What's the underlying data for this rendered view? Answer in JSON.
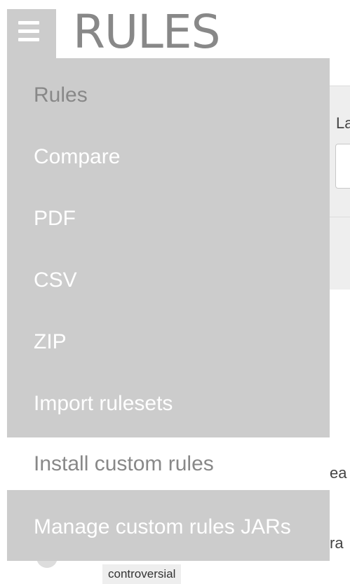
{
  "header": {
    "title": "RULES",
    "menu_icon": "hamburger-menu-icon"
  },
  "menu": {
    "items": [
      {
        "label": "Rules",
        "state": "current"
      },
      {
        "label": "Compare",
        "state": "normal"
      },
      {
        "label": "PDF",
        "state": "normal"
      },
      {
        "label": "CSV",
        "state": "normal"
      },
      {
        "label": "ZIP",
        "state": "normal"
      },
      {
        "label": "Import rulesets",
        "state": "normal"
      },
      {
        "label": "Install custom rules",
        "state": "hovered"
      },
      {
        "label": "Manage custom rules JARs",
        "state": "normal"
      }
    ]
  },
  "background": {
    "label_fragment": "La",
    "text_fragment_1": "ea",
    "text_fragment_2": "ra",
    "tag_label": "controversial"
  },
  "colors": {
    "menu_background": "#cccccc",
    "menu_text": "#ffffff",
    "menu_text_dim": "#888888",
    "hover_background": "#ffffff",
    "title_color": "#888888"
  }
}
